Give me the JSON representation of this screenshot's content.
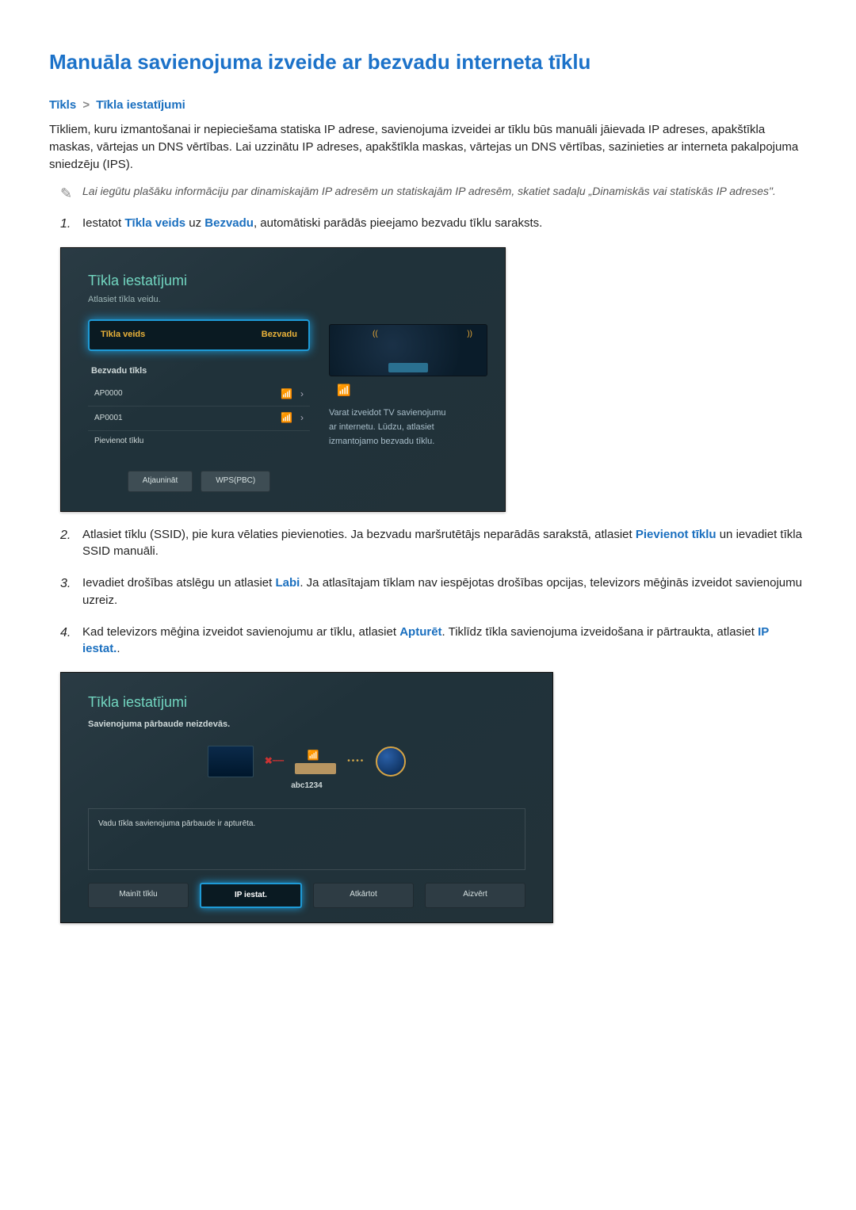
{
  "title": "Manuāla savienojuma izveide ar bezvadu interneta tīklu",
  "breadcrumb": {
    "l1": "Tīkls",
    "sep": ">",
    "l2": "Tīkla iestatījumi"
  },
  "intro": "Tīkliem, kuru izmantošanai ir nepieciešama statiska IP adrese, savienojuma izveidei ar tīklu būs manuāli jāievada IP adreses, apakštīkla maskas, vārtejas un DNS vērtības. Lai uzzinātu IP adreses, apakštīkla maskas, vārtejas un DNS vērtības, sazinieties ar interneta pakalpojuma sniedzēju (IPS).",
  "note": "Lai iegūtu plašāku informāciju par dinamiskajām IP adresēm un statiskajām IP adresēm, skatiet sadaļu „Dinamiskās vai statiskās IP adreses\".",
  "steps": {
    "s1_pre": "Iestatot ",
    "s1_kw1": "Tīkla veids",
    "s1_mid": " uz ",
    "s1_kw2": "Bezvadu",
    "s1_post": ", automātiski parādās pieejamo bezvadu tīklu saraksts.",
    "s2_pre": "Atlasiet tīklu (SSID), pie kura vēlaties pievienoties. Ja bezvadu maršrutētājs neparādās sarakstā, atlasiet ",
    "s2_kw": "Pievienot tīklu",
    "s2_post": " un ievadiet tīkla SSID manuāli.",
    "s3_pre": "Ievadiet drošības atslēgu un atlasiet ",
    "s3_kw": "Labi",
    "s3_post": ". Ja atlasītajam tīklam nav iespējotas drošības opcijas, televizors mēģinās izveidot savienojumu uzreiz.",
    "s4_pre": "Kad televizors mēģina izveidot savienojumu ar tīklu, atlasiet ",
    "s4_kw1": "Apturēt",
    "s4_mid": ". Tiklīdz tīkla savienojuma izveidošana ir pārtraukta, atlasiet ",
    "s4_kw2": "IP iestat.",
    "s4_post": "."
  },
  "tv1": {
    "title": "Tīkla iestatījumi",
    "subtitle": "Atlasiet tīkla veidu.",
    "netTypeLabel": "Tīkla veids",
    "netTypeValue": "Bezvadu",
    "wirelessHdr": "Bezvadu tīkls",
    "ap0": "AP0000",
    "ap1": "AP0001",
    "addNet": "Pievienot tīklu",
    "btnRefresh": "Atjaunināt",
    "btnWps": "WPS(PBC)",
    "rightL1": "Varat izveidot TV savienojumu",
    "rightL2": "ar internetu. Lūdzu, atlasiet",
    "rightL3": "izmantojamo bezvadu tīklu."
  },
  "tv2": {
    "title": "Tīkla iestatījumi",
    "failMsg": "Savienojuma pārbaude neizdevās.",
    "ssid": "abc1234",
    "infoMsg": "Vadu tīkla savienojuma pārbaude ir apturēta.",
    "btnChange": "Mainīt tīklu",
    "btnIp": "IP iestat.",
    "btnRetry": "Atkārtot",
    "btnClose": "Aizvērt"
  },
  "nums": {
    "n1": "1.",
    "n2": "2.",
    "n3": "3.",
    "n4": "4."
  }
}
